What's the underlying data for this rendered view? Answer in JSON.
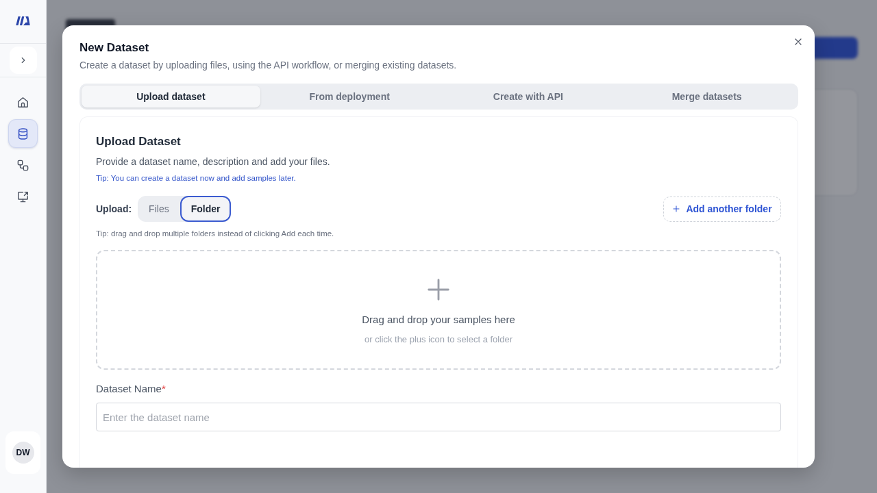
{
  "sidebar": {
    "expanded": false,
    "nav_items": [
      {
        "kind": "home",
        "selected": false
      },
      {
        "kind": "database",
        "selected": true
      },
      {
        "kind": "workflow",
        "selected": false
      },
      {
        "kind": "monitor",
        "selected": false
      }
    ],
    "user": {
      "initials": "DW"
    }
  },
  "dialog": {
    "title": "New Dataset",
    "subtitle": "Create a dataset by uploading files, using the API workflow, or merging existing datasets.",
    "tabs": [
      {
        "label": "Upload dataset",
        "selected": true
      },
      {
        "label": "From deployment",
        "selected": false
      },
      {
        "label": "Create with API",
        "selected": false
      },
      {
        "label": "Merge datasets",
        "selected": false
      }
    ],
    "panel": {
      "title": "Upload Dataset",
      "description": "Provide a dataset name, description and add your files.",
      "tip": "Tip: You can create a dataset now and add samples later.",
      "upload": {
        "label": "Upload:",
        "options": [
          {
            "label": "Files",
            "selected": false
          },
          {
            "label": "Folder",
            "selected": true
          }
        ],
        "add_button": "Add another folder",
        "tip": "Tip: drag and drop multiple folders instead of clicking Add each time."
      },
      "drop_zone": {
        "title": "Drag and drop your samples here",
        "hint": "or click the plus icon to select a folder"
      },
      "dataset_name": {
        "label": "Dataset Name",
        "required_mark": "*",
        "placeholder": "Enter the dataset name"
      }
    }
  }
}
